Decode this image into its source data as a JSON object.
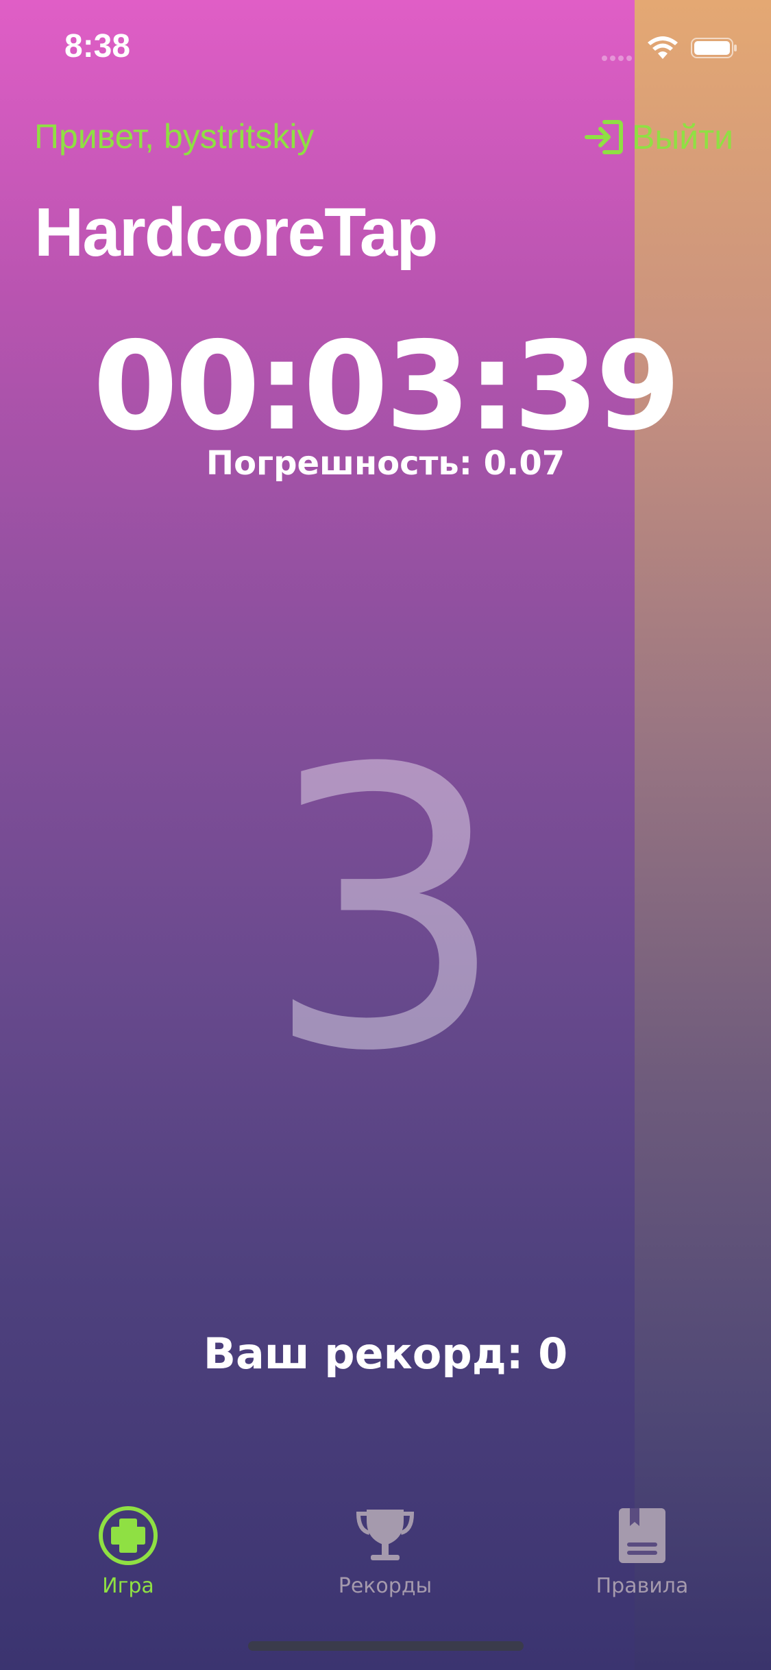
{
  "status_bar": {
    "time": "8:38"
  },
  "header": {
    "greeting": "Привет, bystritskiy",
    "logout_label": "Выйти"
  },
  "app_title": "HardcoreTap",
  "game": {
    "timer": "00:03:39",
    "error_text": "Погрешность: 0.07",
    "countdown": "3",
    "record_text": "Ваш рекорд: 0"
  },
  "tabbar": {
    "items": [
      {
        "label": "Игра",
        "icon": "game-icon",
        "active": true
      },
      {
        "label": "Рекорды",
        "icon": "trophy-icon",
        "active": false
      },
      {
        "label": "Правила",
        "icon": "rules-book-icon",
        "active": false
      }
    ]
  },
  "colors": {
    "accent": "#8fe043",
    "text": "#ffffff",
    "inactive_tab": "#a59aad"
  }
}
